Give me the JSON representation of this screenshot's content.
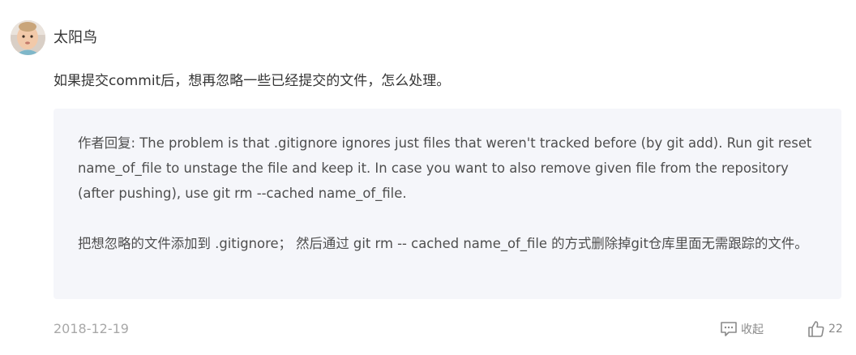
{
  "comment": {
    "username": "太阳鸟",
    "content": "如果提交commit后，想再忽略一些已经提交的文件，怎么处理。",
    "reply": {
      "paragraph1": "作者回复: The problem is that .gitignore ignores just files that weren't tracked before (by git add). Run git reset name_of_file to unstage the file and keep it. In case you want to also remove given file from the repository (after pushing), use git rm --cached name_of_file.",
      "paragraph2": "把想忽略的文件添加到 .gitignore； 然后通过 git rm -- cached name_of_file 的方式删除掉git仓库里面无需跟踪的文件。"
    },
    "date": "2018-12-19",
    "favorite_label": "收起",
    "like_count": "22"
  },
  "icons": {
    "favorite": "message-square-icon",
    "like": "thumbs-up-icon"
  },
  "colors": {
    "reply_background": "#f5f6fa",
    "meta_text": "#a8a8a8",
    "body_text": "#353535"
  }
}
